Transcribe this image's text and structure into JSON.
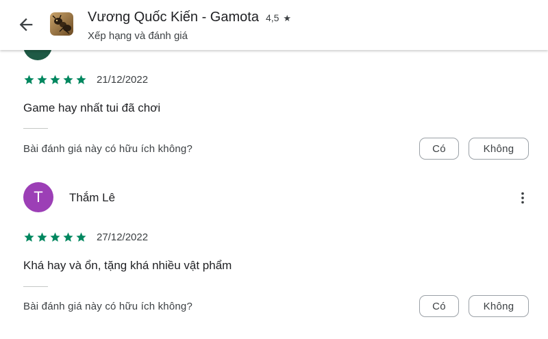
{
  "header": {
    "app_title": "Vương Quốc Kiến - Gamota",
    "rating": "4,5",
    "rating_star": "★",
    "subtitle": "Xếp hạng và đánh giá"
  },
  "icons": {
    "back": "arrow-back-icon",
    "star": "star-icon",
    "more": "more-vert-icon",
    "app": "app-icon"
  },
  "colors": {
    "star": "#01875f",
    "avatar_thamle": "#9c3fb6",
    "avatar_partial": "#1e5a45"
  },
  "reviews": [
    {
      "stars": 5,
      "date": "21/12/2022",
      "text": "Game hay nhất tui đã chơi",
      "helpful_question": "Bài đánh giá này có hữu ích không?",
      "yes_label": "Có",
      "no_label": "Không"
    },
    {
      "avatar_letter": "T",
      "author": "Thắm Lê",
      "stars": 5,
      "date": "27/12/2022",
      "text": "Khá hay và ổn, tặng khá nhiều vật phẩm",
      "helpful_question": "Bài đánh giá này có hữu ích không?",
      "yes_label": "Có",
      "no_label": "Không"
    }
  ]
}
